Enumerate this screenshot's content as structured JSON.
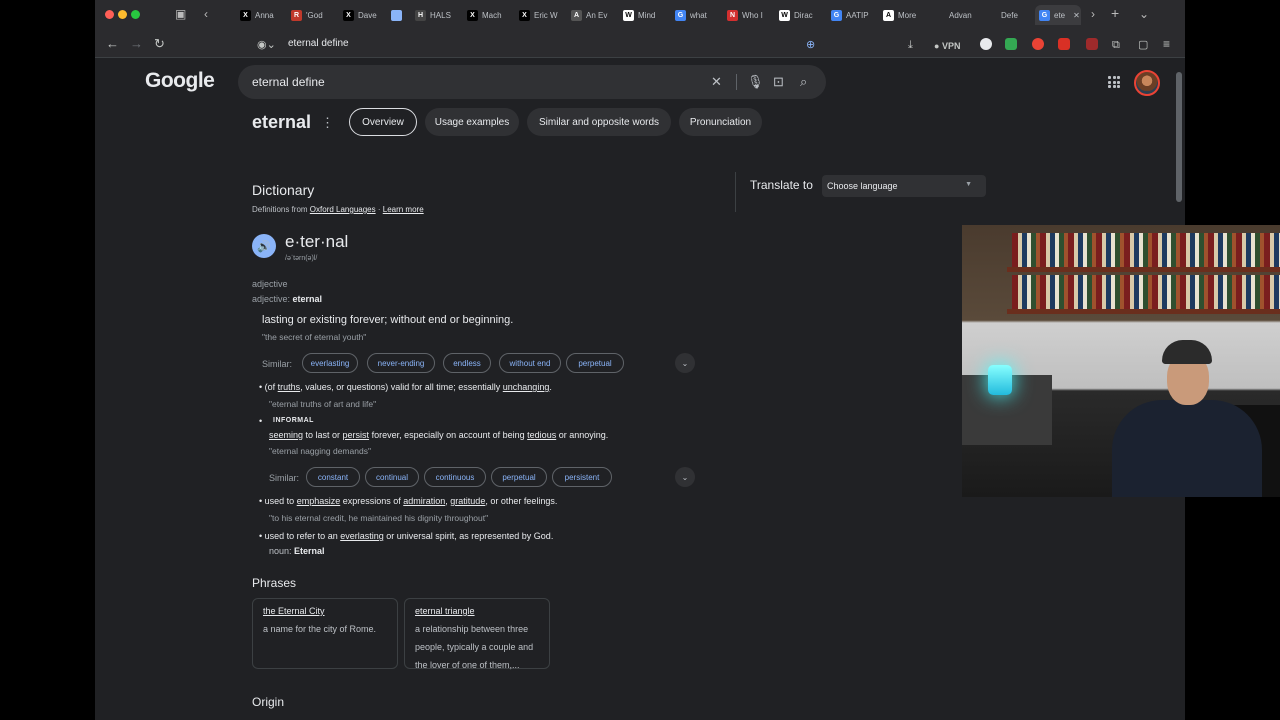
{
  "browser": {
    "tabs": [
      {
        "label": "Anna",
        "fav": "X",
        "color": "#000000"
      },
      {
        "label": "'God",
        "fav": "R",
        "color": "#c0392b"
      },
      {
        "label": "Dave",
        "fav": "X",
        "color": "#000000"
      },
      {
        "label": "HALS",
        "fav": "H",
        "color": "#444444"
      },
      {
        "label": "Mach",
        "fav": "X",
        "color": "#000000"
      },
      {
        "label": "Eric W",
        "fav": "X",
        "color": "#000000"
      },
      {
        "label": "An Ev",
        "fav": "A",
        "color": "#555555"
      },
      {
        "label": "Mind",
        "fav": "W",
        "color": "#ffffff"
      },
      {
        "label": "what",
        "fav": "G",
        "color": "#4285f4"
      },
      {
        "label": "Who I",
        "fav": "N",
        "color": "#d32f2f"
      },
      {
        "label": "Dirac",
        "fav": "W",
        "color": "#ffffff"
      },
      {
        "label": "AATIP",
        "fav": "G",
        "color": "#4285f4"
      },
      {
        "label": "More",
        "fav": "A",
        "color": "#ffffff"
      },
      {
        "label": "Advan",
        "fav": "",
        "color": "#2b2b2e"
      },
      {
        "label": "Defe",
        "fav": "",
        "color": "#2b2b2e"
      },
      {
        "label": "ete",
        "fav": "G",
        "color": "#4285f4"
      }
    ],
    "address": "eternal define",
    "vpn_label": "VPN"
  },
  "google": {
    "logo": "Google",
    "query": "eternal define"
  },
  "word_header": {
    "word": "eternal",
    "tabs": [
      "Overview",
      "Usage examples",
      "Similar and opposite words",
      "Pronunciation"
    ]
  },
  "dictionary": {
    "title": "Dictionary",
    "source_prefix": "Definitions from ",
    "source": "Oxford Languages",
    "learn_more": "Learn more",
    "headword": "e·ter·nal",
    "pronunciation": "/əˈtərn(ə)l/",
    "pos": "adjective",
    "pos2_label": "adjective: ",
    "pos2_word": "eternal",
    "def1": "lasting or existing forever; without end or beginning.",
    "ex1": "\"the secret of eternal youth\"",
    "similar_label": "Similar:",
    "similar1": [
      "everlasting",
      "never-ending",
      "endless",
      "without end",
      "perpetual"
    ],
    "sense2": {
      "p1": "(of ",
      "l1": "truths",
      "p2": ", values, or questions) valid for all time; essentially ",
      "l2": "unchanging",
      "p3": ".",
      "ex": "\"eternal truths of art and life\""
    },
    "informal_tag": "INFORMAL",
    "sense3": {
      "l1": "seeming",
      "p1": " to last or ",
      "l2": "persist",
      "p2": " forever, especially on account of being ",
      "l3": "tedious",
      "p3": " or annoying.",
      "ex": "\"eternal nagging demands\""
    },
    "similar2": [
      "constant",
      "continual",
      "continuous",
      "perpetual",
      "persistent"
    ],
    "sense4": {
      "p1": "used to ",
      "l1": "emphasize",
      "p2": " expressions of ",
      "l2": "admiration",
      "p3": ", ",
      "l3": "gratitude",
      "p4": ", or other feelings.",
      "ex": "\"to his eternal credit, he maintained his dignity throughout\""
    },
    "sense5": {
      "p1": "used to refer to an ",
      "l1": "everlasting",
      "p2": " or universal spirit, as represented by God."
    },
    "noun_label": "noun: ",
    "noun_word": "Eternal"
  },
  "phrases": {
    "title": "Phrases",
    "items": [
      {
        "term": "the Eternal City",
        "def": "a name for the city of Rome."
      },
      {
        "term": "eternal triangle",
        "def": "a relationship between three people, typically a couple and the lover of one of them,..."
      }
    ]
  },
  "origin": {
    "title": "Origin"
  },
  "translate": {
    "label": "Translate to",
    "select": "Choose language"
  }
}
